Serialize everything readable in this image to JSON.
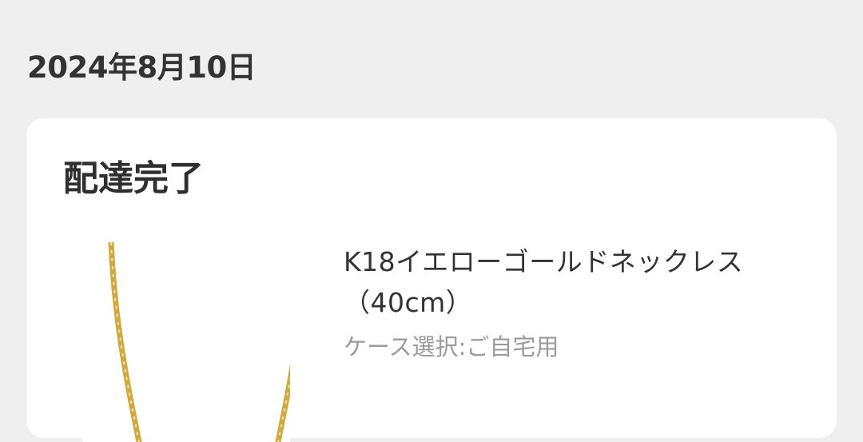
{
  "order_date": "2024年8月10日",
  "order": {
    "status": "配達完了",
    "product": {
      "name": "K18イエローゴールドネックレス（40cm）",
      "option": "ケース選択:ご自宅用",
      "image": "gold-chain-necklace-image"
    }
  },
  "colors": {
    "background": "#efefef",
    "card": "#ffffff",
    "text_primary": "#333333",
    "text_secondary": "#9a9a9a",
    "gold": "#d9b24a"
  }
}
